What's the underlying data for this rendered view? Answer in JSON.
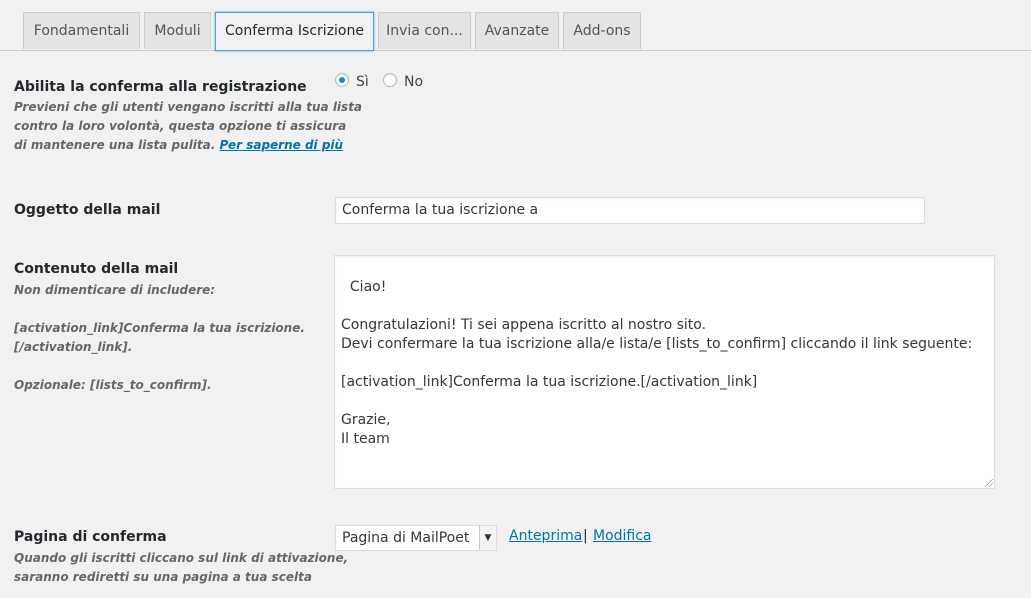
{
  "tabs": [
    {
      "label": "Fondamentali",
      "active": false
    },
    {
      "label": "Moduli",
      "active": false
    },
    {
      "label": "Conferma Iscrizione",
      "active": true
    },
    {
      "label": "Invia con...",
      "active": false
    },
    {
      "label": "Avanzate",
      "active": false
    },
    {
      "label": "Add-ons",
      "active": false
    }
  ],
  "confirm": {
    "label": "Abilita la conferma alla registrazione",
    "desc_line1": "Previeni che gli utenti vengano iscritti alla tua lista",
    "desc_line2": "contro la loro volontà, questa opzione ti assicura",
    "desc_line3": "di mantenere una lista pulita.",
    "learn_more": "Per saperne di più",
    "option_yes": "Sì",
    "option_no": "No",
    "selected": "Sì"
  },
  "subject": {
    "label": "Oggetto della mail",
    "value": "Conferma la tua iscrizione a"
  },
  "content": {
    "label": "Contenuto della mail",
    "desc_line1": "Non dimenticare di includere:",
    "desc_line2": "[activation_link]Conferma la tua iscrizione.",
    "desc_line3": "[/activation_link].",
    "desc_line4": "Opzionale: [lists_to_confirm].",
    "body": "Ciao!\n\nCongratulazioni! Ti sei appena iscritto al nostro sito.\nDevi confermare la tua iscrizione alla/e lista/e [lists_to_confirm] cliccando il link seguente:\n\n[activation_link]Conferma la tua iscrizione.[/activation_link]\n\nGrazie,\nIl team"
  },
  "confirm_page": {
    "label": "Pagina di conferma",
    "desc_line1": "Quando gli iscritti cliccano sul link di attivazione,",
    "desc_line2": "saranno rediretti su una pagina a tua scelta",
    "selected": "Pagina di MailPoet",
    "preview_link": "Anteprima",
    "separator": "|",
    "edit_link": "Modifica"
  },
  "colors": {
    "accent": "#0073aa",
    "radio_checked": "#1e8cbe",
    "active_tab_border": "#5b9dd9"
  },
  "icons": {
    "dropdown": "chevron-down-icon",
    "resize": "resize-grip-icon"
  }
}
